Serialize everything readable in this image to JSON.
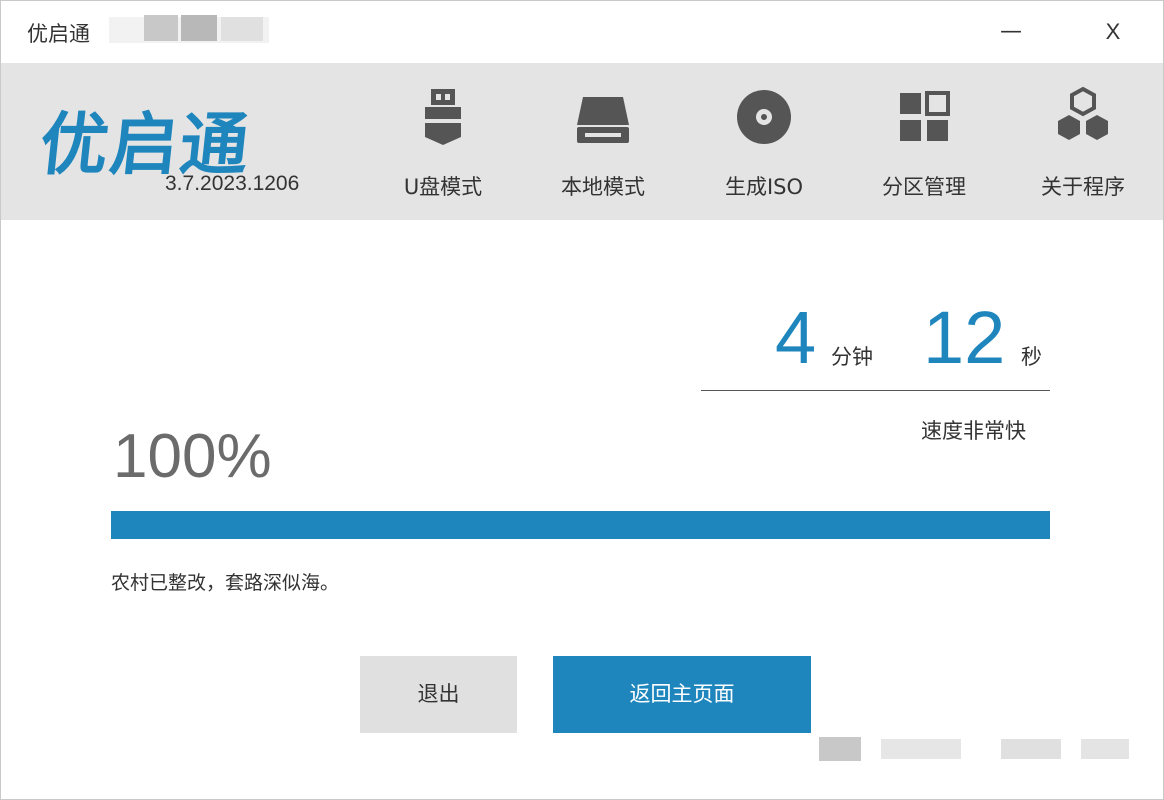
{
  "window": {
    "title": "优启通",
    "minimize_label": "—",
    "close_label": "X"
  },
  "header": {
    "brand": "优启通",
    "version": "3.7.2023.1206",
    "nav": [
      {
        "label": "U盘模式",
        "icon": "usb-drive-icon"
      },
      {
        "label": "本地模式",
        "icon": "hard-drive-icon"
      },
      {
        "label": "生成ISO",
        "icon": "disc-icon"
      },
      {
        "label": "分区管理",
        "icon": "partition-grid-icon"
      },
      {
        "label": "关于程序",
        "icon": "hexagon-cluster-icon"
      }
    ]
  },
  "main": {
    "timer": {
      "minutes": "4",
      "minutes_unit": "分钟",
      "seconds": "12",
      "seconds_unit": "秒"
    },
    "speed": "速度非常快",
    "percent_text": "100%",
    "progress": 1.0,
    "message": "农村已整改，套路深似海。",
    "exit_button": "退出",
    "home_button": "返回主页面"
  },
  "colors": {
    "accent": "#1f86bd",
    "header_bg": "#e4e4e4",
    "track": "#dcdcdc"
  }
}
